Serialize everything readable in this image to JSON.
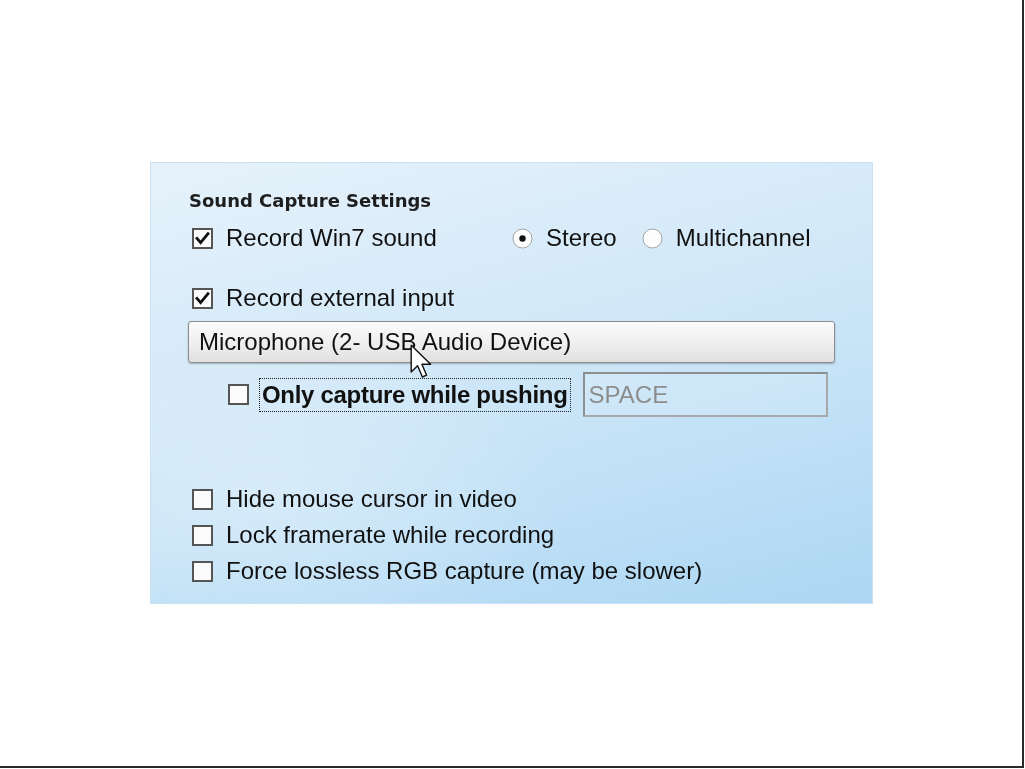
{
  "panel": {
    "title": "Sound Capture Settings",
    "record_sound": {
      "label": "Record Win7 sound",
      "checked": true
    },
    "channel_mode": [
      {
        "label": "Stereo",
        "selected": true
      },
      {
        "label": "Multichannel",
        "selected": false
      }
    ],
    "external_input": {
      "label": "Record external input",
      "checked": true
    },
    "device": {
      "value": "Microphone (2- USB Audio Device)"
    },
    "push_to_talk": {
      "label": "Only capture while pushing",
      "checked": false,
      "focused": true
    },
    "hotkey": {
      "value": "SPACE",
      "disabled": true
    },
    "options": [
      {
        "label": "Hide mouse cursor in video",
        "checked": false
      },
      {
        "label": "Lock framerate while recording",
        "checked": false
      },
      {
        "label": "Force lossless RGB capture (may be slower)",
        "checked": false
      }
    ]
  }
}
